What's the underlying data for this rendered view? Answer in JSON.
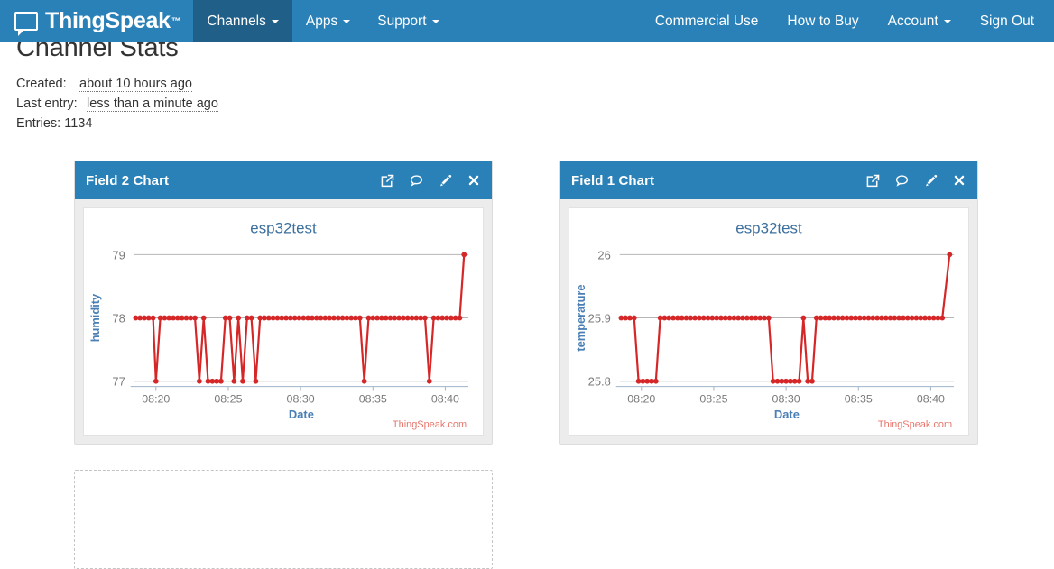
{
  "navbar": {
    "brand": "ThingSpeak",
    "brand_tm": "™",
    "brand_logo_icon": "speech-bubble-logo-icon",
    "left_items": [
      {
        "label": "Channels",
        "caret": true,
        "active": true
      },
      {
        "label": "Apps",
        "caret": true,
        "active": false
      },
      {
        "label": "Support",
        "caret": true,
        "active": false
      }
    ],
    "right_items": [
      {
        "label": "Commercial Use",
        "caret": false
      },
      {
        "label": "How to Buy",
        "caret": false
      },
      {
        "label": "Account",
        "caret": true
      },
      {
        "label": "Sign Out",
        "caret": false
      }
    ],
    "bg_color": "#2a81b8",
    "active_bg_color": "#1f5f88"
  },
  "page": {
    "title": "Channel Stats",
    "stats": {
      "created_label": "Created:",
      "created_value": "about 10 hours ago",
      "last_entry_label": "Last entry:",
      "last_entry_value": "less than a minute ago",
      "entries_label": "Entries:",
      "entries_value": "1134"
    }
  },
  "panels": [
    {
      "id": "field2",
      "title": "Field 2 Chart",
      "icons": [
        {
          "name": "external-link-icon",
          "title": "Open in new window"
        },
        {
          "name": "comment-icon",
          "title": "Add comment"
        },
        {
          "name": "pencil-icon",
          "title": "Edit"
        },
        {
          "name": "close-icon",
          "title": "Close"
        }
      ]
    },
    {
      "id": "field1",
      "title": "Field 1 Chart",
      "icons": [
        {
          "name": "external-link-icon",
          "title": "Open in new window"
        },
        {
          "name": "comment-icon",
          "title": "Add comment"
        },
        {
          "name": "pencil-icon",
          "title": "Edit"
        },
        {
          "name": "close-icon",
          "title": "Close"
        }
      ]
    }
  ],
  "chart_data": [
    {
      "id": "field2",
      "type": "line",
      "title": "esp32test",
      "xlabel": "Date",
      "ylabel": "humidity",
      "watermark": "ThingSpeak.com",
      "line_color": "#d62728",
      "title_color": "#3c6f9e",
      "axis_label_color": "#4a7fb5",
      "tick_color": "#7a7a7a",
      "grid": true,
      "legend": "none",
      "ylim": [
        77,
        79
      ],
      "yticks": [
        77,
        78,
        79
      ],
      "ytick_labels": [
        "77",
        "78",
        "79"
      ],
      "xlim": [
        "08:18.5",
        "08:41.5"
      ],
      "xticks": [
        "08:20",
        "08:25",
        "08:30",
        "08:35",
        "08:40"
      ],
      "xtick_labels": [
        "08:20",
        "08:25",
        "08:30",
        "08:35",
        "08:40"
      ],
      "x": [
        18.6,
        18.9,
        19.2,
        19.5,
        19.8,
        20.0,
        20.3,
        20.6,
        20.9,
        21.2,
        21.5,
        21.8,
        22.1,
        22.4,
        22.7,
        23.0,
        23.3,
        23.6,
        23.9,
        24.2,
        24.5,
        24.8,
        25.1,
        25.4,
        25.7,
        26.0,
        26.3,
        26.6,
        26.9,
        27.2,
        27.5,
        27.8,
        28.1,
        28.4,
        28.7,
        29.0,
        29.3,
        29.6,
        29.9,
        30.2,
        30.5,
        30.8,
        31.1,
        31.4,
        31.7,
        32.0,
        32.3,
        32.6,
        32.9,
        33.2,
        33.5,
        33.8,
        34.1,
        34.4,
        34.7,
        35.0,
        35.3,
        35.6,
        35.9,
        36.2,
        36.5,
        36.8,
        37.1,
        37.4,
        37.7,
        38.0,
        38.3,
        38.6,
        38.9,
        39.2,
        39.5,
        39.8,
        40.1,
        40.4,
        40.7,
        41.0,
        41.3
      ],
      "values": [
        78,
        78,
        78,
        78,
        78,
        77,
        78,
        78,
        78,
        78,
        78,
        78,
        78,
        78,
        78,
        77,
        78,
        77,
        77,
        77,
        77,
        78,
        78,
        77,
        78,
        77,
        78,
        78,
        77,
        78,
        78,
        78,
        78,
        78,
        78,
        78,
        78,
        78,
        78,
        78,
        78,
        78,
        78,
        78,
        78,
        78,
        78,
        78,
        78,
        78,
        78,
        78,
        78,
        77,
        78,
        78,
        78,
        78,
        78,
        78,
        78,
        78,
        78,
        78,
        78,
        78,
        78,
        78,
        77,
        78,
        78,
        78,
        78,
        78,
        78,
        78,
        79
      ]
    },
    {
      "id": "field1",
      "type": "line",
      "title": "esp32test",
      "xlabel": "Date",
      "ylabel": "temperature",
      "watermark": "ThingSpeak.com",
      "line_color": "#d62728",
      "title_color": "#3c6f9e",
      "axis_label_color": "#4a7fb5",
      "tick_color": "#7a7a7a",
      "grid": true,
      "legend": "none",
      "ylim": [
        25.8,
        26.0
      ],
      "yticks": [
        25.8,
        25.9,
        26.0
      ],
      "ytick_labels": [
        "25.8",
        "25.9",
        "26"
      ],
      "xlim": [
        "08:18.5",
        "08:41.5"
      ],
      "xticks": [
        "08:20",
        "08:25",
        "08:30",
        "08:35",
        "08:40"
      ],
      "xtick_labels": [
        "08:20",
        "08:25",
        "08:30",
        "08:35",
        "08:40"
      ],
      "x": [
        18.6,
        18.9,
        19.2,
        19.5,
        19.8,
        20.1,
        20.4,
        20.7,
        21.0,
        21.3,
        21.6,
        21.9,
        22.2,
        22.5,
        22.8,
        23.1,
        23.4,
        23.7,
        24.0,
        24.3,
        24.6,
        24.9,
        25.2,
        25.5,
        25.8,
        26.1,
        26.4,
        26.7,
        27.0,
        27.3,
        27.6,
        27.9,
        28.2,
        28.5,
        28.8,
        29.1,
        29.4,
        29.7,
        30.0,
        30.3,
        30.6,
        30.9,
        31.2,
        31.5,
        31.8,
        32.1,
        32.4,
        32.7,
        33.0,
        33.3,
        33.6,
        33.9,
        34.2,
        34.5,
        34.8,
        35.1,
        35.4,
        35.7,
        36.0,
        36.3,
        36.6,
        36.9,
        37.2,
        37.5,
        37.8,
        38.1,
        38.4,
        38.7,
        39.0,
        39.3,
        39.6,
        39.9,
        40.2,
        40.5,
        40.8,
        41.3
      ],
      "values": [
        25.9,
        25.9,
        25.9,
        25.9,
        25.8,
        25.8,
        25.8,
        25.8,
        25.8,
        25.9,
        25.9,
        25.9,
        25.9,
        25.9,
        25.9,
        25.9,
        25.9,
        25.9,
        25.9,
        25.9,
        25.9,
        25.9,
        25.9,
        25.9,
        25.9,
        25.9,
        25.9,
        25.9,
        25.9,
        25.9,
        25.9,
        25.9,
        25.9,
        25.9,
        25.9,
        25.8,
        25.8,
        25.8,
        25.8,
        25.8,
        25.8,
        25.8,
        25.9,
        25.8,
        25.8,
        25.9,
        25.9,
        25.9,
        25.9,
        25.9,
        25.9,
        25.9,
        25.9,
        25.9,
        25.9,
        25.9,
        25.9,
        25.9,
        25.9,
        25.9,
        25.9,
        25.9,
        25.9,
        25.9,
        25.9,
        25.9,
        25.9,
        25.9,
        25.9,
        25.9,
        25.9,
        25.9,
        25.9,
        25.9,
        25.9,
        26.0
      ]
    }
  ],
  "placeholder": {
    "name": "add-widget-placeholder"
  }
}
